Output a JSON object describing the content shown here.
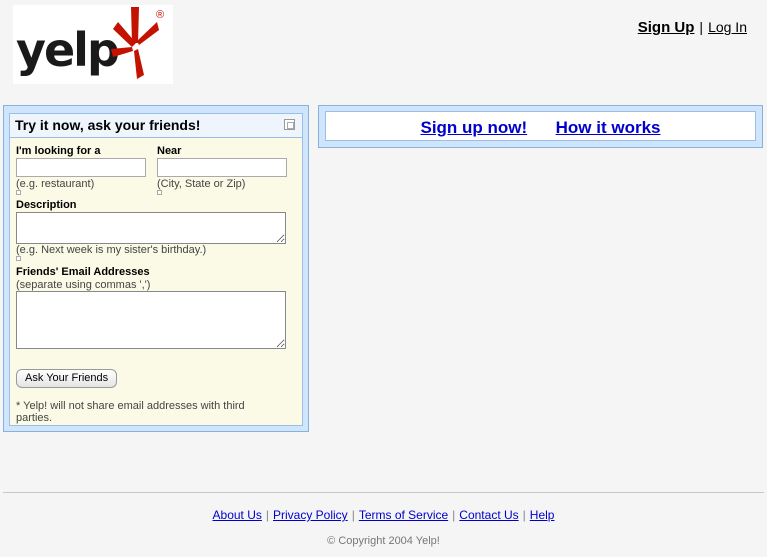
{
  "logo": {
    "text": "yelp",
    "reg_mark": "®",
    "burst_color": "#c41200"
  },
  "header": {
    "signup": "Sign Up",
    "separator": "|",
    "login": "Log In"
  },
  "ask_panel": {
    "title": "Try it now, ask your friends!",
    "looking_for": {
      "label": "I'm looking for a",
      "value": "",
      "hint": "(e.g. restaurant)"
    },
    "near": {
      "label": "Near",
      "value": "",
      "hint": "(City, State or Zip)"
    },
    "description": {
      "label": "Description",
      "value": "",
      "hint": "(e.g. Next week is my sister's birthday.)"
    },
    "emails": {
      "label": "Friends' Email Addresses",
      "sublabel": "(separate using commas ',')",
      "value": ""
    },
    "button": "Ask Your Friends",
    "disclaimer": "* Yelp! will not share email addresses with third parties."
  },
  "promo": {
    "signup_now": "Sign up now!",
    "how_it_works": "How it works"
  },
  "footer": {
    "links": [
      "About Us",
      "Privacy Policy",
      "Terms of Service",
      "Contact Us",
      "Help"
    ],
    "separator": "|",
    "copyright": "© Copyright 2004 Yelp!"
  }
}
